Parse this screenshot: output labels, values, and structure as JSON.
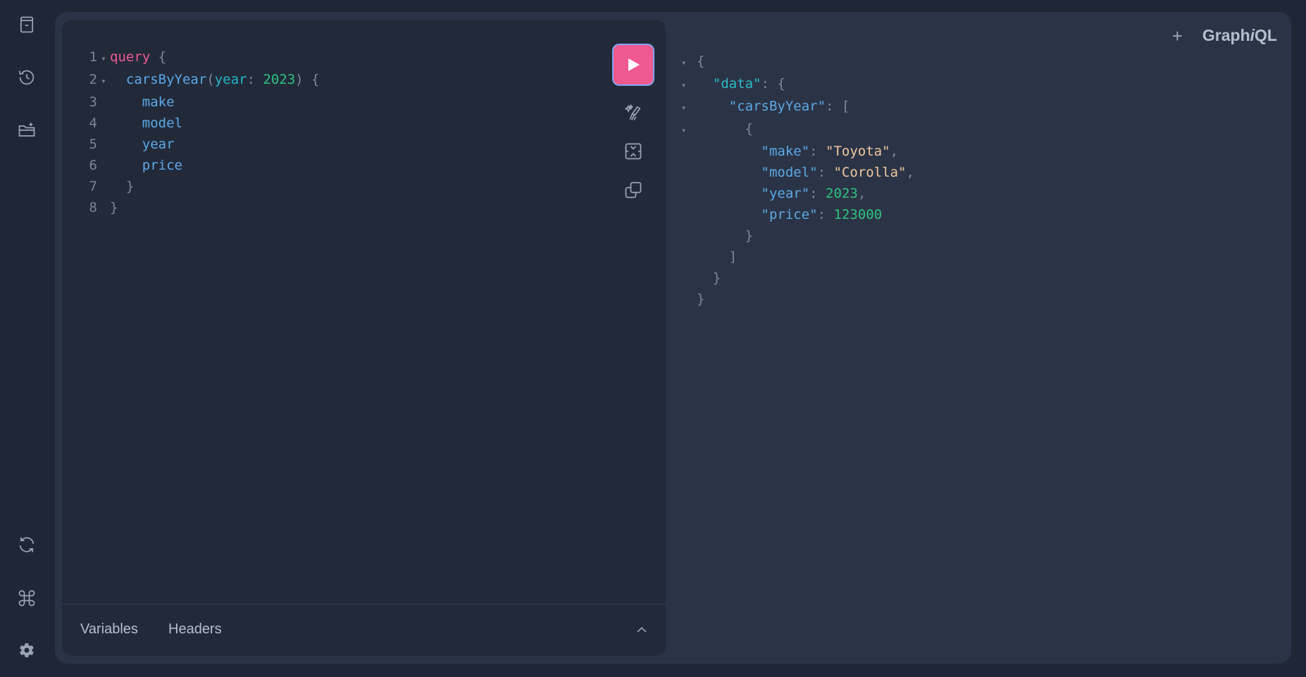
{
  "app": {
    "logo_prefix": "Graph",
    "logo_italic": "i",
    "logo_suffix": "QL",
    "new_tab_label": "+"
  },
  "sidebar": {
    "top_icons": [
      "docs-icon",
      "history-icon",
      "folder-plus-icon"
    ],
    "bottom_icons": [
      "refresh-icon",
      "command-icon",
      "settings-icon"
    ]
  },
  "editor": {
    "lines": [
      {
        "n": "1",
        "tokens": [
          {
            "t": "query",
            "c": "kw"
          },
          {
            "t": " {",
            "c": "punc"
          }
        ]
      },
      {
        "n": "2",
        "tokens": [
          {
            "t": "  carsByYear",
            "c": "fn"
          },
          {
            "t": "(",
            "c": "punc"
          },
          {
            "t": "year",
            "c": "arg"
          },
          {
            "t": ": ",
            "c": "punc"
          },
          {
            "t": "2023",
            "c": "num"
          },
          {
            "t": ") {",
            "c": "punc"
          }
        ]
      },
      {
        "n": "3",
        "tokens": [
          {
            "t": "    make",
            "c": "field"
          }
        ]
      },
      {
        "n": "4",
        "tokens": [
          {
            "t": "    model",
            "c": "field"
          }
        ]
      },
      {
        "n": "5",
        "tokens": [
          {
            "t": "    year",
            "c": "field"
          }
        ]
      },
      {
        "n": "6",
        "tokens": [
          {
            "t": "    price",
            "c": "field"
          }
        ]
      },
      {
        "n": "7",
        "tokens": [
          {
            "t": "  }",
            "c": "punc"
          }
        ]
      },
      {
        "n": "8",
        "tokens": [
          {
            "t": "}",
            "c": "punc"
          }
        ]
      }
    ],
    "folds": [
      "1",
      "2"
    ]
  },
  "toolbar": {
    "tools": [
      "prettify-icon",
      "merge-fragments-icon",
      "copy-icon"
    ]
  },
  "bottom": {
    "variables_label": "Variables",
    "headers_label": "Headers"
  },
  "result": {
    "lines": [
      {
        "fold": true,
        "tokens": [
          {
            "t": "{",
            "c": "punc"
          }
        ]
      },
      {
        "fold": true,
        "tokens": [
          {
            "t": "  ",
            "c": "punc"
          },
          {
            "t": "\"data\"",
            "c": "keyc"
          },
          {
            "t": ": {",
            "c": "punc"
          }
        ]
      },
      {
        "fold": true,
        "tokens": [
          {
            "t": "    ",
            "c": "punc"
          },
          {
            "t": "\"carsByYear\"",
            "c": "key"
          },
          {
            "t": ": [",
            "c": "punc"
          }
        ]
      },
      {
        "fold": true,
        "tokens": [
          {
            "t": "      {",
            "c": "punc"
          }
        ]
      },
      {
        "fold": false,
        "tokens": [
          {
            "t": "        ",
            "c": "punc"
          },
          {
            "t": "\"make\"",
            "c": "key"
          },
          {
            "t": ": ",
            "c": "punc"
          },
          {
            "t": "\"Toyota\"",
            "c": "str"
          },
          {
            "t": ",",
            "c": "punc"
          }
        ]
      },
      {
        "fold": false,
        "tokens": [
          {
            "t": "        ",
            "c": "punc"
          },
          {
            "t": "\"model\"",
            "c": "key"
          },
          {
            "t": ": ",
            "c": "punc"
          },
          {
            "t": "\"Corolla\"",
            "c": "str"
          },
          {
            "t": ",",
            "c": "punc"
          }
        ]
      },
      {
        "fold": false,
        "tokens": [
          {
            "t": "        ",
            "c": "punc"
          },
          {
            "t": "\"year\"",
            "c": "key"
          },
          {
            "t": ": ",
            "c": "punc"
          },
          {
            "t": "2023",
            "c": "num"
          },
          {
            "t": ",",
            "c": "punc"
          }
        ]
      },
      {
        "fold": false,
        "tokens": [
          {
            "t": "        ",
            "c": "punc"
          },
          {
            "t": "\"price\"",
            "c": "key"
          },
          {
            "t": ": ",
            "c": "punc"
          },
          {
            "t": "123000",
            "c": "num"
          }
        ]
      },
      {
        "fold": false,
        "tokens": [
          {
            "t": "      }",
            "c": "punc"
          }
        ]
      },
      {
        "fold": false,
        "tokens": [
          {
            "t": "    ]",
            "c": "punc"
          }
        ]
      },
      {
        "fold": false,
        "tokens": [
          {
            "t": "  }",
            "c": "punc"
          }
        ]
      },
      {
        "fold": false,
        "tokens": [
          {
            "t": "}",
            "c": "punc"
          }
        ]
      }
    ]
  },
  "colors": {
    "accent": "#ee5a8f",
    "background": "#1f2737",
    "panel": "#2b3446",
    "editor": "#222a3a"
  }
}
